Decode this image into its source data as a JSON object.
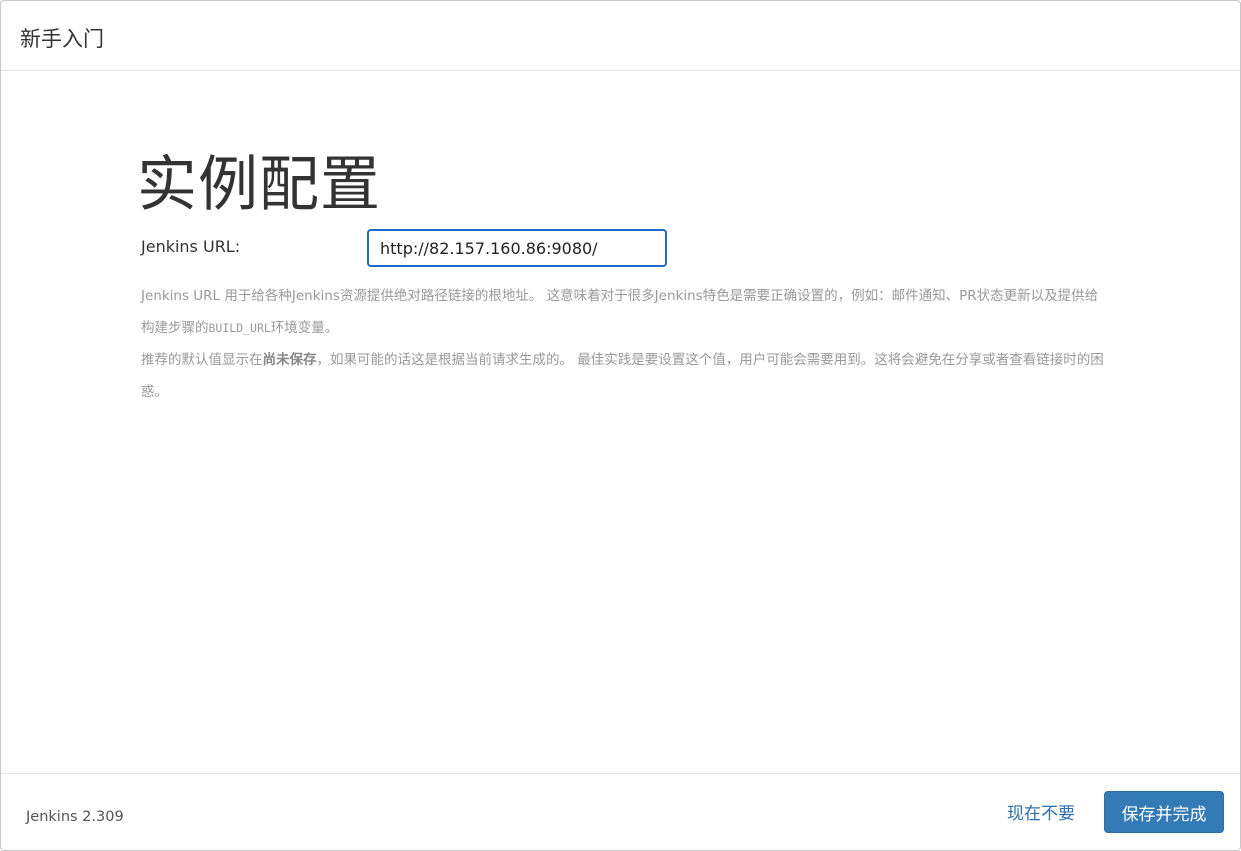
{
  "header": {
    "title": "新手入门"
  },
  "main": {
    "heading": "实例配置",
    "url_label": "Jenkins URL:",
    "url_value": "http://82.157.160.86:9080/",
    "help_1_text_a": "Jenkins URL 用于给各种Jenkins资源提供绝对路径链接的根地址。 这意味着对于很多Jenkins特色是需要正确设置的，例如：邮件通知、PR状态更新以及提供给构建步骤的",
    "help_1_code": "BUILD_URL",
    "help_1_text_b": "环境变量。",
    "help_2_text_a": "推荐的默认值显示在",
    "help_2_strong": "尚未保存",
    "help_2_text_b": "，如果可能的话这是根据当前请求生成的。 最佳实践是要设置这个值，用户可能会需要用到。这将会避免在分享或者查看链接时的困惑。"
  },
  "footer": {
    "version": "Jenkins 2.309",
    "skip_label": "现在不要",
    "save_label": "保存并完成"
  },
  "colors": {
    "primary_button": "#337ab7",
    "link": "#2d6fad",
    "input_focus_border": "#1f6bcc"
  }
}
